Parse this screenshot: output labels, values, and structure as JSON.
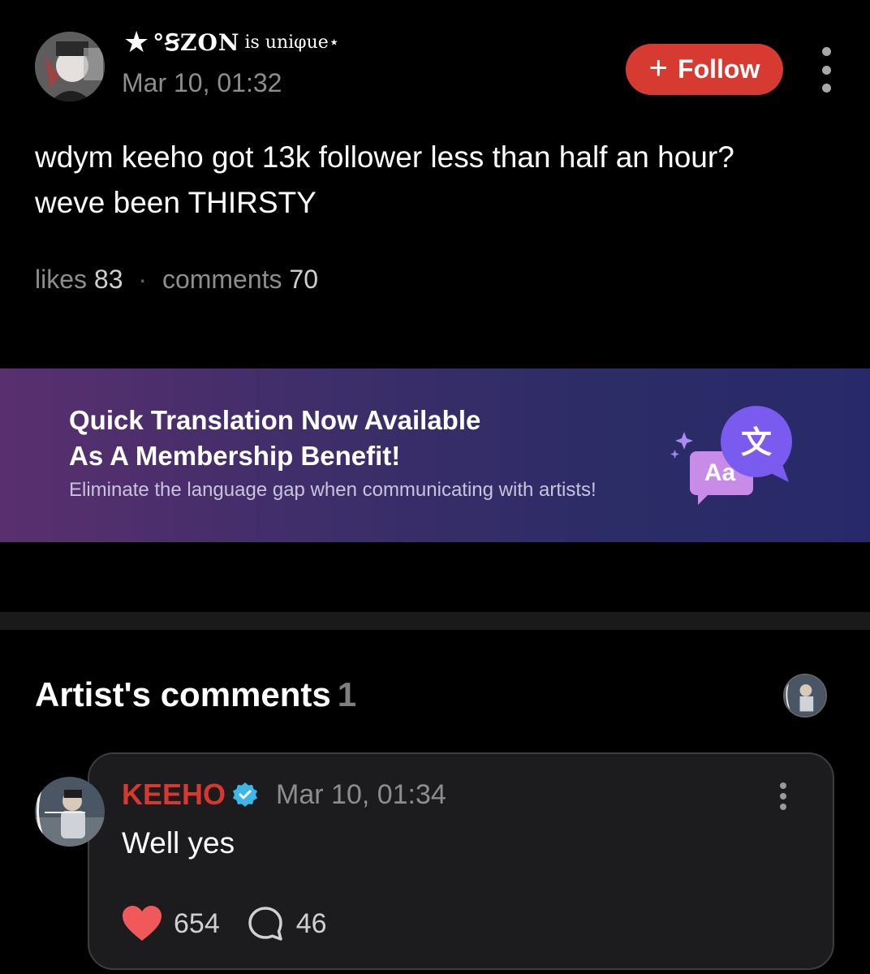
{
  "post": {
    "author": {
      "badge_icon": "star-icon",
      "username": "°ꞨZON",
      "username_suffix": "is uniφue⋆"
    },
    "date": "Mar 10, 01:32",
    "follow_label": "Follow",
    "body_lines": [
      "wdym keeho got 13k follower less than half an hour?",
      "weve been THIRSTY"
    ],
    "stats": {
      "likes_label": "likes",
      "likes": "83",
      "comments_label": "comments",
      "comments": "70"
    }
  },
  "banner": {
    "title_line1": "Quick Translation Now Available",
    "title_line2": "As A Membership Benefit!",
    "subtitle": "Eliminate the language gap when communicating with artists!",
    "icon": "translate-icon",
    "icon_glyphs": [
      "文",
      "Aa"
    ]
  },
  "artist_comments": {
    "title": "Artist's comments",
    "count": "1",
    "comment": {
      "author": "KEEHO",
      "verified": true,
      "date": "Mar 10, 01:34",
      "text": "Well yes",
      "likes": "654",
      "replies": "46"
    }
  },
  "colors": {
    "accent": "#d63a31",
    "background": "#000000",
    "muted_text": "#8d8d8d",
    "verified": "#3fb6e8"
  }
}
